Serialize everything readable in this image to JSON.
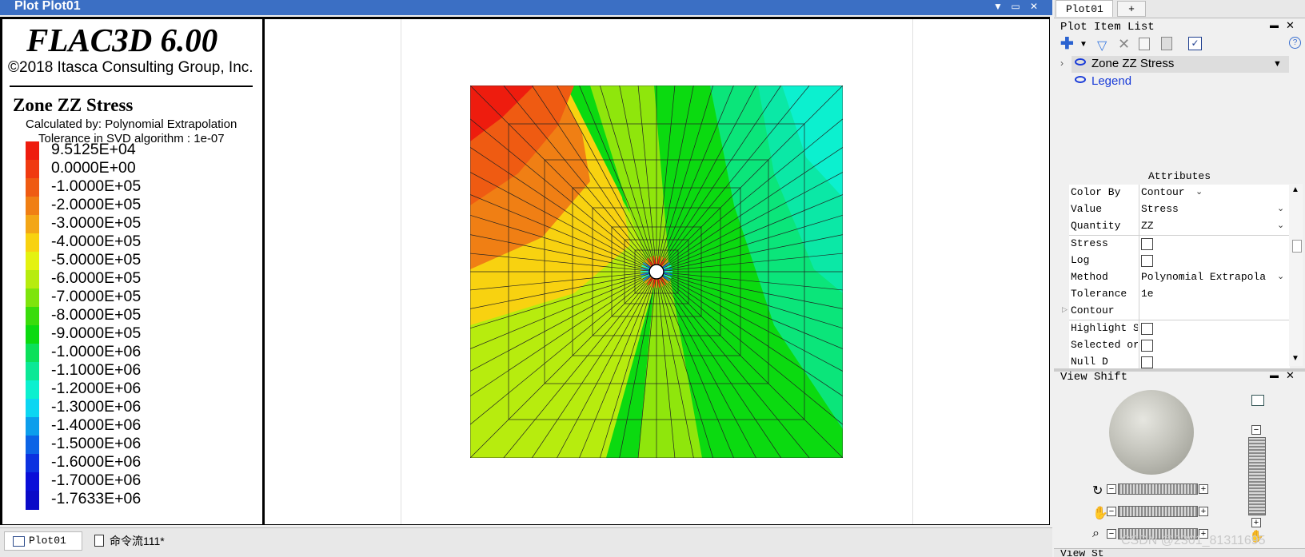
{
  "window": {
    "title": "Plot Plot01"
  },
  "legend": {
    "app_title": "FLAC3D 6.00",
    "copyright": "©2018 Itasca Consulting Group, Inc.",
    "plot_title": "Zone ZZ Stress",
    "calculated_by": "Calculated by: Polynomial Extrapolation",
    "tolerance_text": "Tolerance in SVD algorithm : 1e-07",
    "entries": [
      {
        "label": "9.5125E+04",
        "color": "#ee1c0e"
      },
      {
        "label": "0.0000E+00",
        "color": "#f03a10"
      },
      {
        "label": "-1.0000E+05",
        "color": "#ef5b12"
      },
      {
        "label": "-2.0000E+05",
        "color": "#f07f14"
      },
      {
        "label": "-3.0000E+05",
        "color": "#f3a616"
      },
      {
        "label": "-4.0000E+05",
        "color": "#f8d210"
      },
      {
        "label": "-5.0000E+05",
        "color": "#e4f210"
      },
      {
        "label": "-6.0000E+05",
        "color": "#b7ec0e"
      },
      {
        "label": "-7.0000E+05",
        "color": "#7ee40c"
      },
      {
        "label": "-8.0000E+05",
        "color": "#39dc0b"
      },
      {
        "label": "-9.0000E+05",
        "color": "#0bda10"
      },
      {
        "label": "-1.0000E+06",
        "color": "#0be05a"
      },
      {
        "label": "-1.1000E+06",
        "color": "#0be896"
      },
      {
        "label": "-1.2000E+06",
        "color": "#0cf0cf"
      },
      {
        "label": "-1.3000E+06",
        "color": "#0cd6f2"
      },
      {
        "label": "-1.4000E+06",
        "color": "#0c9eec"
      },
      {
        "label": "-1.5000E+06",
        "color": "#0c64e6"
      },
      {
        "label": "-1.6000E+06",
        "color": "#0c32e0"
      },
      {
        "label": "-1.7000E+06",
        "color": "#0a0ed8"
      },
      {
        "label": "-1.7633E+06",
        "color": "#0a0ac8"
      }
    ]
  },
  "right_panel": {
    "tabs": [
      "Plot01",
      "+"
    ],
    "plot_item_list_title": "Plot Item List",
    "items": [
      {
        "label": "Zone ZZ Stress",
        "color": "#000000"
      },
      {
        "label": "Legend",
        "color": "#1a3cd8"
      }
    ],
    "attributes_title": "Attributes",
    "attributes": [
      {
        "name": "Color By",
        "value": "Contour",
        "type": "dropdown"
      },
      {
        "name": "Value",
        "value": "Stress",
        "type": "dropdown"
      },
      {
        "name": "Quantity",
        "value": "ZZ",
        "type": "dropdown"
      },
      {
        "name": "Stress",
        "value": "",
        "type": "checkbox"
      },
      {
        "name": "Log",
        "value": "",
        "type": "checkbox"
      },
      {
        "name": "Method",
        "value": "Polynomial Extrapola",
        "type": "dropdown"
      },
      {
        "name": "Tolerance",
        "value": "1e",
        "type": "text"
      },
      {
        "name": "Contour",
        "value": "",
        "type": "expand"
      },
      {
        "name": "Highlight S",
        "value": "",
        "type": "checkbox"
      },
      {
        "name": "Selected or",
        "value": "",
        "type": "checkbox"
      },
      {
        "name": "Null D",
        "value": "",
        "type": "checkbox"
      }
    ],
    "view_shift_title": "View Shift",
    "next_panel_title": "View St"
  },
  "bottom_tabs": [
    "Plot01",
    "命令流111*"
  ],
  "watermark": "CSDN @2301_81311695",
  "contour_colors": {
    "red": "#ee1c0e",
    "orange": "#f07f14",
    "yellow": "#f8d210",
    "lime": "#b7ec0e",
    "green": "#0bda10",
    "mint": "#0be896",
    "cyan": "#0cf0cf",
    "blue": "#0c64e6"
  }
}
